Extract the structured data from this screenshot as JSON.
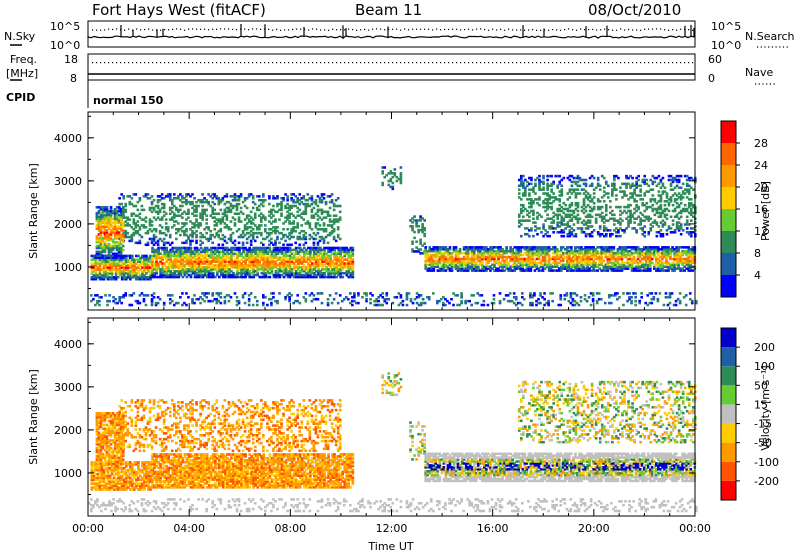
{
  "header": {
    "station": "Fort Hays West (fitACF)",
    "beam": "Beam 11",
    "date": "08/Oct/2010"
  },
  "panels": {
    "noise": {
      "left_label": "N.Sky",
      "right_label": "N.Search",
      "top_tick": "10^5",
      "bottom_tick": "10^0"
    },
    "freq": {
      "left_label_1": "Freq.",
      "left_label_2": "[MHz]",
      "right_label": "Nave",
      "left_ticks": [
        "18",
        "8"
      ],
      "right_ticks": [
        "60",
        "0"
      ]
    },
    "cpid": {
      "label": "CPID",
      "value": "normal 150"
    }
  },
  "colors": {
    "power_scale": [
      "#0000ff",
      "#1e5fa8",
      "#2e8b57",
      "#66cc33",
      "#ffcc00",
      "#ff9900",
      "#ff6600",
      "#ff0000"
    ],
    "velocity_scale": [
      "#ff0000",
      "#ff5500",
      "#ff9900",
      "#ffcc00",
      "#c0c0c0",
      "#66cc33",
      "#2e8b57",
      "#1e5fa8",
      "#0000cc"
    ]
  },
  "chart_data": [
    {
      "type": "heatmap",
      "name": "power",
      "xlabel": "",
      "ylabel": "Slant Range [km]",
      "xlim": [
        0,
        24
      ],
      "ylim": [
        0,
        4600
      ],
      "y_ticks": [
        1000,
        2000,
        3000,
        4000
      ],
      "colorbar_label": "Power [dB]",
      "colorbar_ticks": [
        "4",
        "8",
        "12",
        "16",
        "20",
        "24",
        "28"
      ],
      "echo_bands": [
        {
          "x": [
            0.1,
            2.5
          ],
          "y": [
            700,
            1250
          ]
        },
        {
          "x": [
            2.5,
            10.5
          ],
          "y": [
            750,
            1450
          ]
        },
        {
          "x": [
            1.2,
            10.0
          ],
          "y": [
            1500,
            2700
          ]
        },
        {
          "x": [
            0.3,
            1.4
          ],
          "y": [
            1200,
            2400
          ]
        },
        {
          "x": [
            11.6,
            12.4
          ],
          "y": [
            2800,
            3300
          ]
        },
        {
          "x": [
            12.7,
            13.3
          ],
          "y": [
            1300,
            2200
          ]
        },
        {
          "x": [
            13.3,
            24.0
          ],
          "y": [
            900,
            1450
          ]
        },
        {
          "x": [
            17.0,
            24.0
          ],
          "y": [
            1700,
            3100
          ]
        },
        {
          "x": [
            0.0,
            24.0
          ],
          "y": [
            100,
            400
          ]
        }
      ]
    },
    {
      "type": "heatmap",
      "name": "velocity",
      "xlabel": "Time UT",
      "ylabel": "Slant Range [km]",
      "xlim": [
        0,
        24
      ],
      "ylim": [
        0,
        4600
      ],
      "x_ticks": [
        "00:00",
        "04:00",
        "08:00",
        "12:00",
        "16:00",
        "20:00",
        "00:00"
      ],
      "y_ticks": [
        1000,
        2000,
        3000,
        4000
      ],
      "colorbar_label": "Velocity [m s⁻¹]",
      "colorbar_ticks": [
        "200",
        "100",
        "50",
        "15",
        "-15",
        "-50",
        "-100",
        "-200"
      ],
      "echo_bands": [
        {
          "x": [
            0.1,
            2.5
          ],
          "y": [
            600,
            1250
          ]
        },
        {
          "x": [
            2.5,
            10.5
          ],
          "y": [
            650,
            1450
          ]
        },
        {
          "x": [
            1.2,
            10.0
          ],
          "y": [
            1500,
            2700
          ]
        },
        {
          "x": [
            0.3,
            1.4
          ],
          "y": [
            1200,
            2400
          ]
        },
        {
          "x": [
            11.6,
            12.4
          ],
          "y": [
            2800,
            3300
          ]
        },
        {
          "x": [
            12.7,
            13.3
          ],
          "y": [
            1300,
            2200
          ]
        },
        {
          "x": [
            13.3,
            24.0
          ],
          "y": [
            800,
            1450
          ]
        },
        {
          "x": [
            17.0,
            24.0
          ],
          "y": [
            1700,
            3100
          ]
        },
        {
          "x": [
            0.0,
            24.0
          ],
          "y": [
            100,
            400
          ]
        }
      ]
    }
  ]
}
